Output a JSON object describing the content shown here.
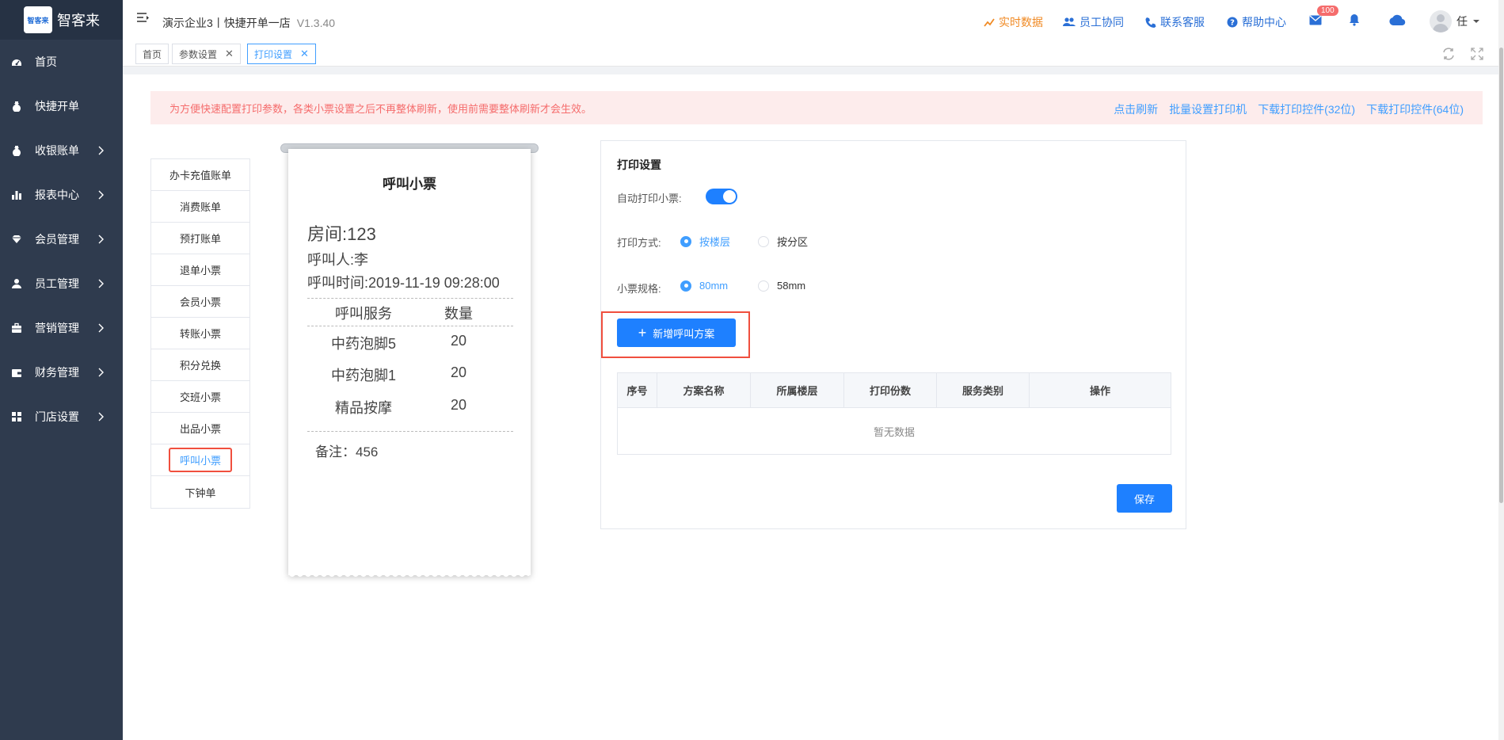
{
  "sidebar": {
    "logo_text": "智客来",
    "logo_box_text": "智客来",
    "items": [
      {
        "label": "首页",
        "icon": "dashboard-icon"
      },
      {
        "label": "快捷开单",
        "icon": "money-bag-icon"
      },
      {
        "label": "收银账单",
        "icon": "money-bag-icon"
      },
      {
        "label": "报表中心",
        "icon": "bar-chart-icon"
      },
      {
        "label": "会员管理",
        "icon": "diamond-icon"
      },
      {
        "label": "员工管理",
        "icon": "user-icon"
      },
      {
        "label": "营销管理",
        "icon": "briefcase-icon"
      },
      {
        "label": "财务管理",
        "icon": "wallet-icon"
      },
      {
        "label": "门店设置",
        "icon": "grid-icon"
      }
    ]
  },
  "header": {
    "company": "演示企业3丨快捷开单一店",
    "version": "V1.3.40",
    "links": {
      "realtime": "实时数据",
      "staff": "员工协同",
      "contact": "联系客服",
      "help": "帮助中心"
    },
    "mail_badge": "100",
    "user_initial": "任"
  },
  "tabs": [
    {
      "label": "首页"
    },
    {
      "label": "参数设置"
    },
    {
      "label": "打印设置"
    }
  ],
  "notice": {
    "text": "为方便快速配置打印参数，各类小票设置之后不再整体刷新，使用前需要整体刷新才会生效。",
    "links": [
      "点击刷新",
      "批量设置打印机",
      "下载打印控件(32位)",
      "下载打印控件(64位)"
    ]
  },
  "ticket_list": [
    "办卡充值账单",
    "消费账单",
    "预打账单",
    "退单小票",
    "会员小票",
    "转账小票",
    "积分兑换",
    "交班小票",
    "出品小票",
    "呼叫小票",
    "下钟单"
  ],
  "receipt": {
    "title": "呼叫小票",
    "room": "房间:123",
    "caller": "呼叫人:李",
    "time": "呼叫时间:2019-11-19 09:28:00",
    "col_service": "呼叫服务",
    "col_qty": "数量",
    "rows": [
      {
        "service": "中药泡脚5",
        "qty": "20"
      },
      {
        "service": "中药泡脚1",
        "qty": "20"
      },
      {
        "service": "精品按摩",
        "qty": "20"
      }
    ],
    "note": "备注：456"
  },
  "settings": {
    "title": "打印设置",
    "auto_print_label": "自动打印小票:",
    "auto_print_on": true,
    "print_mode_label": "打印方式:",
    "print_mode_options": [
      "按楼层",
      "按分区"
    ],
    "print_mode_selected": "按楼层",
    "size_label": "小票规格:",
    "size_options": [
      "80mm",
      "58mm"
    ],
    "size_selected": "80mm",
    "add_button": "新增呼叫方案",
    "table_headers": [
      "序号",
      "方案名称",
      "所属楼层",
      "打印份数",
      "服务类别",
      "操作"
    ],
    "table_empty": "暂无数据",
    "save_button": "保存"
  },
  "colors": {
    "primary": "#1e80ff",
    "sidebar_bg": "#2f3b4e",
    "highlight_border": "#f04f3e",
    "notice_bg": "#fdecec",
    "notice_text": "#f56c6c",
    "realtime_orange": "#f08a24"
  }
}
